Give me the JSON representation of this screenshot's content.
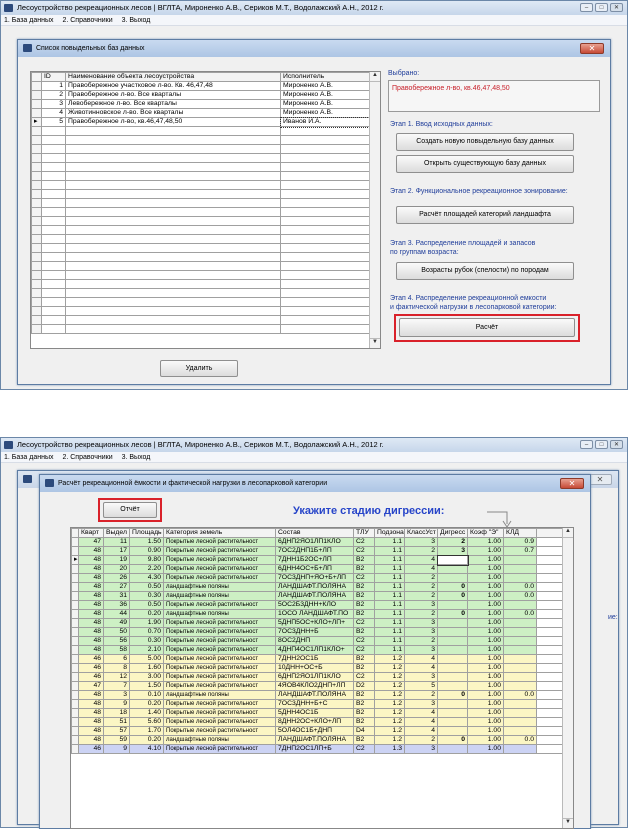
{
  "app": {
    "title": "Лесоустройство рекреационных лесов |  ВГЛТА, Мироненко А.В., Сериков М.Т., Водолажский А.Н., 2012 г.",
    "menu": [
      "1. База данных",
      "2. Справочники",
      "3. Выход"
    ]
  },
  "dialog1": {
    "title": "Список повыдельных баз данных",
    "columns": [
      "ID",
      "Наименование объекта лесоустройства",
      "Исполнитель"
    ],
    "rows": [
      [
        "1",
        "Правобережное участковое л-во. Кв. 46,47,48",
        "Мироненко А.В."
      ],
      [
        "2",
        "Правобережное л-во. Все кварталы",
        "Мироненко А.В."
      ],
      [
        "3",
        "Левобережное л-во.  Все кварталы",
        "Мироненко А.В."
      ],
      [
        "4",
        "Животинновское л-во. Все кварталы",
        "Мироненко А.В."
      ],
      [
        "5",
        "Правобережное л-во, кв.46,47,48,50",
        "Иванов И.А."
      ]
    ],
    "selected_label": "Выбрано:",
    "selected_value": "Правобережное л-во, кв.46,47,48,50",
    "stage1": "Этап 1. Ввод исходных данных:",
    "btn_create": "Создать новую повыдельную базу данных",
    "btn_open": "Открыть существующую базу данных",
    "stage2": "Этап 2. Функциональное рекреационное зонирование:",
    "btn_area": "Расчёт площадей категорий ландшафта",
    "stage3_l1": "Этап 3. Распределение площадей и запасов",
    "stage3_l2": "по группам возраста:",
    "btn_age": "Возрасты рубок (спелости) по породам",
    "stage4_l1": "Этап 4. Распределение рекреационной емкости",
    "stage4_l2": "и фактической нагрузки в лесопарковой категории:",
    "btn_calc": "Расчёт",
    "btn_delete": "Удалить"
  },
  "dialog2": {
    "title": "Расчёт рекреационной ёмкости и фактической нагрузки в лесопарковой категории",
    "btn_report": "Отчёт",
    "heading": "Укажите стадию дигрессии:",
    "side_label": "ие:",
    "columns": [
      "Кварт",
      "Выдел",
      "Площадь",
      "Категория земель",
      "Состав",
      "ТЛУ",
      "Подзона",
      "КлассУст",
      "Дигресс",
      "Коэф \"Э\"",
      "КЛД"
    ],
    "rows": [
      [
        "47",
        "11",
        "1.50",
        "Покрытые лесной растительност",
        "6ДНП2ЯО1ЛП1КЛО",
        "С2",
        "1.1",
        "3",
        "2",
        "1.00",
        "0.9",
        "g"
      ],
      [
        "48",
        "17",
        "0.90",
        "Покрытые лесной растительност",
        "7ОС2ДНП1Б+ЛП",
        "С2",
        "1.1",
        "2",
        "3",
        "1.00",
        "0.7",
        "g"
      ],
      [
        "48",
        "19",
        "9.80",
        "Покрытые лесной растительност",
        "7ДНН1Б2ОС+ЛП",
        "В2",
        "1.1",
        "4",
        "",
        "1.00",
        "",
        "g"
      ],
      [
        "48",
        "20",
        "2.20",
        "Покрытые лесной растительност",
        "6ДНН4ОС+Б+ЛП",
        "В2",
        "1.1",
        "4",
        "",
        "1.00",
        "",
        "g"
      ],
      [
        "48",
        "26",
        "4.30",
        "Покрытые лесной растительност",
        "7ОС3ДНП+ЯО+Б+ЛП",
        "С2",
        "1.1",
        "2",
        "",
        "1.00",
        "",
        "g"
      ],
      [
        "48",
        "27",
        "0.50",
        "ландшафтные поляны",
        "ЛАНДШАФТ.ПОЛЯНА",
        "В2",
        "1.1",
        "2",
        "0",
        "1.00",
        "0.0",
        "g"
      ],
      [
        "48",
        "31",
        "0.30",
        "ландшафтные поляны",
        "ЛАНДШАФТ.ПОЛЯНА",
        "В2",
        "1.1",
        "2",
        "0",
        "1.00",
        "0.0",
        "g"
      ],
      [
        "48",
        "36",
        "0.50",
        "Покрытые лесной растительност",
        "5ОС2Б3ДНН+КЛО",
        "В2",
        "1.1",
        "3",
        "",
        "1.00",
        "",
        "g"
      ],
      [
        "48",
        "44",
        "0.20",
        "ландшафтные поляны",
        "1ОСО ЛАНДШАФТ.ПО",
        "В2",
        "1.1",
        "2",
        "0",
        "1.00",
        "0.0",
        "g"
      ],
      [
        "48",
        "49",
        "1.90",
        "Покрытые лесной растительност",
        "5ДНП5ОС+КЛО+ЛП+",
        "С2",
        "1.1",
        "3",
        "",
        "1.00",
        "",
        "g"
      ],
      [
        "48",
        "50",
        "0.70",
        "Покрытые лесной растительност",
        "7ОС3ДНН+Б",
        "В2",
        "1.1",
        "3",
        "",
        "1.00",
        "",
        "g"
      ],
      [
        "48",
        "56",
        "0.30",
        "Покрытые лесной растительност",
        "8ОС2ДНП",
        "С2",
        "1.1",
        "2",
        "",
        "1.00",
        "",
        "g"
      ],
      [
        "48",
        "58",
        "2.10",
        "Покрытые лесной растительност",
        "4ДНП4ОС1ЛП1КЛО+",
        "С2",
        "1.1",
        "3",
        "",
        "1.00",
        "",
        "g"
      ],
      [
        "46",
        "6",
        "5.00",
        "Покрытые лесной растительност",
        "7ДНН2ОС1Б",
        "В2",
        "1.2",
        "4",
        "",
        "1.00",
        "",
        "y"
      ],
      [
        "46",
        "8",
        "1.60",
        "Покрытые лесной растительност",
        "10ДНН+ОС+Б",
        "В2",
        "1.2",
        "4",
        "",
        "1.00",
        "",
        "y"
      ],
      [
        "46",
        "12",
        "3.00",
        "Покрытые лесной растительност",
        "6ДНП2ЯО1ЛП1КЛО",
        "С2",
        "1.2",
        "3",
        "",
        "1.00",
        "",
        "y"
      ],
      [
        "47",
        "7",
        "1.50",
        "Покрытые лесной растительност",
        "4ЯОВ4КЛО2ДНП+ЛП",
        "D2",
        "1.2",
        "5",
        "",
        "1.00",
        "",
        "y"
      ],
      [
        "48",
        "3",
        "0.10",
        "ландшафтные поляны",
        "ЛАНДШАФТ.ПОЛЯНА",
        "В2",
        "1.2",
        "2",
        "0",
        "1.00",
        "0.0",
        "y"
      ],
      [
        "48",
        "9",
        "0.20",
        "Покрытые лесной растительност",
        "7ОС3ДНН+Б+С",
        "В2",
        "1.2",
        "3",
        "",
        "1.00",
        "",
        "y"
      ],
      [
        "48",
        "18",
        "1.40",
        "Покрытые лесной растительност",
        "5ДНН4ОС1Б",
        "В2",
        "1.2",
        "4",
        "",
        "1.00",
        "",
        "y"
      ],
      [
        "48",
        "51",
        "5.60",
        "Покрытые лесной растительност",
        "8ДНН2ОС+КЛО+ЛП",
        "В2",
        "1.2",
        "4",
        "",
        "1.00",
        "",
        "y"
      ],
      [
        "48",
        "57",
        "1.70",
        "Покрытые лесной растительност",
        "5ОЛ4ОС1Б+ДНП",
        "D4",
        "1.2",
        "4",
        "",
        "1.00",
        "",
        "y"
      ],
      [
        "48",
        "59",
        "0.20",
        "ландшафтные поляны",
        "ЛАНДШАФТ.ПОЛЯНА",
        "В2",
        "1.2",
        "2",
        "0",
        "1.00",
        "0.0",
        "y"
      ],
      [
        "46",
        "9",
        "4.10",
        "Покрытые лесной растительност",
        "7ДНП2ОС1ЛП+Б",
        "С2",
        "1.3",
        "3",
        "",
        "1.00",
        "",
        "b"
      ]
    ]
  }
}
